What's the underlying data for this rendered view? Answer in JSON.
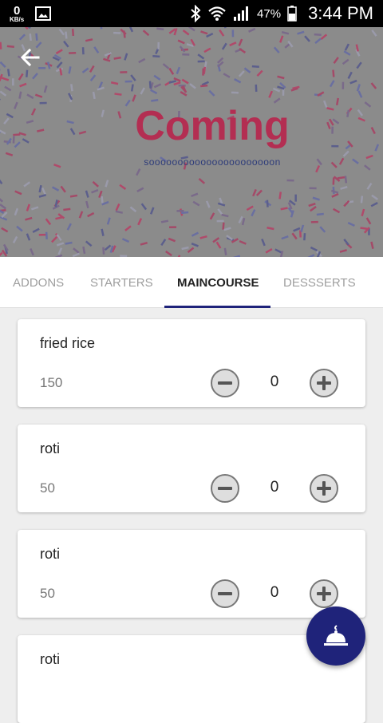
{
  "status_bar": {
    "speed_value": "0",
    "speed_unit": "KB/s",
    "battery": "47%",
    "time": "3:44 PM"
  },
  "header": {
    "banner_title": "Coming",
    "banner_subtitle": "soooooooooooooooooooooon",
    "colors": {
      "title": "#b32e52",
      "subtitle": "#2d3b7a"
    }
  },
  "tabs": [
    {
      "label": "ADDONS",
      "active": false
    },
    {
      "label": "STARTERS",
      "active": false
    },
    {
      "label": "MAINCOURSE",
      "active": true
    },
    {
      "label": "DESSSERTS",
      "active": false
    }
  ],
  "items": [
    {
      "name": "fried rice",
      "price": "150",
      "quantity": "0"
    },
    {
      "name": "roti",
      "price": "50",
      "quantity": "0"
    },
    {
      "name": "roti",
      "price": "50",
      "quantity": "0"
    },
    {
      "name": "roti"
    }
  ],
  "fab": {
    "icon": "cloche-icon",
    "color": "#1f237a"
  },
  "accent_color": "#1f237a"
}
